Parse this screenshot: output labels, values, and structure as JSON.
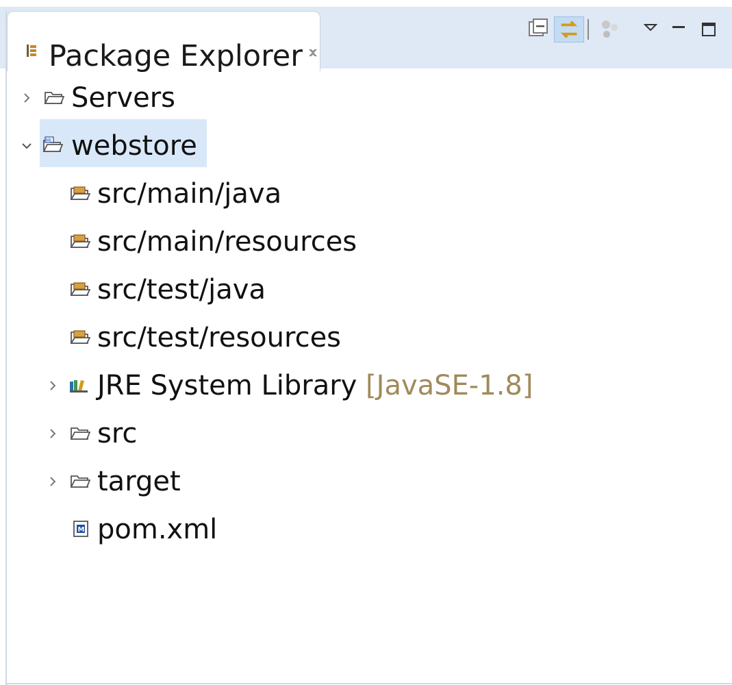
{
  "view": {
    "title": "Package Explorer",
    "toolbar": {
      "collapse_all_icon": "collapse-all-icon",
      "link_with_editor_icon": "link-with-editor-icon",
      "filter_icon": "filter-icon",
      "view_menu_icon": "view-menu-icon",
      "minimize_icon": "minimize-icon",
      "maximize_icon": "maximize-icon"
    }
  },
  "tree": {
    "servers": {
      "label": "Servers",
      "expanded": false
    },
    "webstore": {
      "label": "webstore",
      "expanded": true,
      "selected": true
    },
    "children": [
      {
        "label": "src/main/java",
        "icon": "source-folder-icon"
      },
      {
        "label": "src/main/resources",
        "icon": "source-folder-icon"
      },
      {
        "label": "src/test/java",
        "icon": "source-folder-icon"
      },
      {
        "label": "src/test/resources",
        "icon": "source-folder-icon"
      },
      {
        "label": "JRE System Library",
        "decoration": "[JavaSE-1.8]",
        "icon": "library-icon",
        "expandable": true
      },
      {
        "label": "src",
        "icon": "folder-icon",
        "expandable": true
      },
      {
        "label": "target",
        "icon": "folder-icon",
        "expandable": true
      },
      {
        "label": "pom.xml",
        "icon": "maven-file-icon"
      }
    ]
  },
  "colors": {
    "header_bg": "#dfe8f5",
    "selection_bg": "#d9e8f8",
    "decoration_text": "#a08a5a"
  }
}
